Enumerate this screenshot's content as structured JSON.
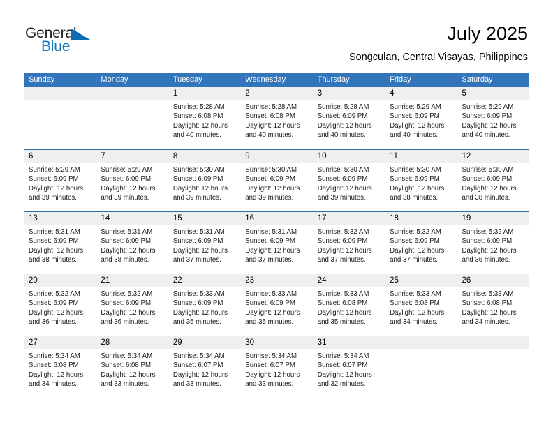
{
  "brand": {
    "name_part1": "General",
    "name_part2": "Blue",
    "accent_color": "#1878be",
    "triangle_color": "#0b6cb3"
  },
  "header": {
    "month_title": "July 2025",
    "location": "Songculan, Central Visayas, Philippines"
  },
  "calendar": {
    "header_color": "#3275ba",
    "separator_color": "#2e6da8",
    "daynum_bar_color": "#efefef",
    "day_names": [
      "Sunday",
      "Monday",
      "Tuesday",
      "Wednesday",
      "Thursday",
      "Friday",
      "Saturday"
    ],
    "weeks": [
      [
        {
          "day": "",
          "empty": true,
          "sunrise": "",
          "sunset": "",
          "daylight": ""
        },
        {
          "day": "",
          "empty": true,
          "sunrise": "",
          "sunset": "",
          "daylight": ""
        },
        {
          "day": "1",
          "empty": false,
          "sunrise": "Sunrise: 5:28 AM",
          "sunset": "Sunset: 6:08 PM",
          "daylight": "Daylight: 12 hours and 40 minutes."
        },
        {
          "day": "2",
          "empty": false,
          "sunrise": "Sunrise: 5:28 AM",
          "sunset": "Sunset: 6:08 PM",
          "daylight": "Daylight: 12 hours and 40 minutes."
        },
        {
          "day": "3",
          "empty": false,
          "sunrise": "Sunrise: 5:28 AM",
          "sunset": "Sunset: 6:09 PM",
          "daylight": "Daylight: 12 hours and 40 minutes."
        },
        {
          "day": "4",
          "empty": false,
          "sunrise": "Sunrise: 5:29 AM",
          "sunset": "Sunset: 6:09 PM",
          "daylight": "Daylight: 12 hours and 40 minutes."
        },
        {
          "day": "5",
          "empty": false,
          "sunrise": "Sunrise: 5:29 AM",
          "sunset": "Sunset: 6:09 PM",
          "daylight": "Daylight: 12 hours and 40 minutes."
        }
      ],
      [
        {
          "day": "6",
          "empty": false,
          "sunrise": "Sunrise: 5:29 AM",
          "sunset": "Sunset: 6:09 PM",
          "daylight": "Daylight: 12 hours and 39 minutes."
        },
        {
          "day": "7",
          "empty": false,
          "sunrise": "Sunrise: 5:29 AM",
          "sunset": "Sunset: 6:09 PM",
          "daylight": "Daylight: 12 hours and 39 minutes."
        },
        {
          "day": "8",
          "empty": false,
          "sunrise": "Sunrise: 5:30 AM",
          "sunset": "Sunset: 6:09 PM",
          "daylight": "Daylight: 12 hours and 39 minutes."
        },
        {
          "day": "9",
          "empty": false,
          "sunrise": "Sunrise: 5:30 AM",
          "sunset": "Sunset: 6:09 PM",
          "daylight": "Daylight: 12 hours and 39 minutes."
        },
        {
          "day": "10",
          "empty": false,
          "sunrise": "Sunrise: 5:30 AM",
          "sunset": "Sunset: 6:09 PM",
          "daylight": "Daylight: 12 hours and 39 minutes."
        },
        {
          "day": "11",
          "empty": false,
          "sunrise": "Sunrise: 5:30 AM",
          "sunset": "Sunset: 6:09 PM",
          "daylight": "Daylight: 12 hours and 38 minutes."
        },
        {
          "day": "12",
          "empty": false,
          "sunrise": "Sunrise: 5:30 AM",
          "sunset": "Sunset: 6:09 PM",
          "daylight": "Daylight: 12 hours and 38 minutes."
        }
      ],
      [
        {
          "day": "13",
          "empty": false,
          "sunrise": "Sunrise: 5:31 AM",
          "sunset": "Sunset: 6:09 PM",
          "daylight": "Daylight: 12 hours and 38 minutes."
        },
        {
          "day": "14",
          "empty": false,
          "sunrise": "Sunrise: 5:31 AM",
          "sunset": "Sunset: 6:09 PM",
          "daylight": "Daylight: 12 hours and 38 minutes."
        },
        {
          "day": "15",
          "empty": false,
          "sunrise": "Sunrise: 5:31 AM",
          "sunset": "Sunset: 6:09 PM",
          "daylight": "Daylight: 12 hours and 37 minutes."
        },
        {
          "day": "16",
          "empty": false,
          "sunrise": "Sunrise: 5:31 AM",
          "sunset": "Sunset: 6:09 PM",
          "daylight": "Daylight: 12 hours and 37 minutes."
        },
        {
          "day": "17",
          "empty": false,
          "sunrise": "Sunrise: 5:32 AM",
          "sunset": "Sunset: 6:09 PM",
          "daylight": "Daylight: 12 hours and 37 minutes."
        },
        {
          "day": "18",
          "empty": false,
          "sunrise": "Sunrise: 5:32 AM",
          "sunset": "Sunset: 6:09 PM",
          "daylight": "Daylight: 12 hours and 37 minutes."
        },
        {
          "day": "19",
          "empty": false,
          "sunrise": "Sunrise: 5:32 AM",
          "sunset": "Sunset: 6:09 PM",
          "daylight": "Daylight: 12 hours and 36 minutes."
        }
      ],
      [
        {
          "day": "20",
          "empty": false,
          "sunrise": "Sunrise: 5:32 AM",
          "sunset": "Sunset: 6:09 PM",
          "daylight": "Daylight: 12 hours and 36 minutes."
        },
        {
          "day": "21",
          "empty": false,
          "sunrise": "Sunrise: 5:32 AM",
          "sunset": "Sunset: 6:09 PM",
          "daylight": "Daylight: 12 hours and 36 minutes."
        },
        {
          "day": "22",
          "empty": false,
          "sunrise": "Sunrise: 5:33 AM",
          "sunset": "Sunset: 6:09 PM",
          "daylight": "Daylight: 12 hours and 35 minutes."
        },
        {
          "day": "23",
          "empty": false,
          "sunrise": "Sunrise: 5:33 AM",
          "sunset": "Sunset: 6:09 PM",
          "daylight": "Daylight: 12 hours and 35 minutes."
        },
        {
          "day": "24",
          "empty": false,
          "sunrise": "Sunrise: 5:33 AM",
          "sunset": "Sunset: 6:08 PM",
          "daylight": "Daylight: 12 hours and 35 minutes."
        },
        {
          "day": "25",
          "empty": false,
          "sunrise": "Sunrise: 5:33 AM",
          "sunset": "Sunset: 6:08 PM",
          "daylight": "Daylight: 12 hours and 34 minutes."
        },
        {
          "day": "26",
          "empty": false,
          "sunrise": "Sunrise: 5:33 AM",
          "sunset": "Sunset: 6:08 PM",
          "daylight": "Daylight: 12 hours and 34 minutes."
        }
      ],
      [
        {
          "day": "27",
          "empty": false,
          "sunrise": "Sunrise: 5:34 AM",
          "sunset": "Sunset: 6:08 PM",
          "daylight": "Daylight: 12 hours and 34 minutes."
        },
        {
          "day": "28",
          "empty": false,
          "sunrise": "Sunrise: 5:34 AM",
          "sunset": "Sunset: 6:08 PM",
          "daylight": "Daylight: 12 hours and 33 minutes."
        },
        {
          "day": "29",
          "empty": false,
          "sunrise": "Sunrise: 5:34 AM",
          "sunset": "Sunset: 6:07 PM",
          "daylight": "Daylight: 12 hours and 33 minutes."
        },
        {
          "day": "30",
          "empty": false,
          "sunrise": "Sunrise: 5:34 AM",
          "sunset": "Sunset: 6:07 PM",
          "daylight": "Daylight: 12 hours and 33 minutes."
        },
        {
          "day": "31",
          "empty": false,
          "sunrise": "Sunrise: 5:34 AM",
          "sunset": "Sunset: 6:07 PM",
          "daylight": "Daylight: 12 hours and 32 minutes."
        },
        {
          "day": "",
          "empty": true,
          "sunrise": "",
          "sunset": "",
          "daylight": ""
        },
        {
          "day": "",
          "empty": true,
          "sunrise": "",
          "sunset": "",
          "daylight": ""
        }
      ]
    ]
  }
}
